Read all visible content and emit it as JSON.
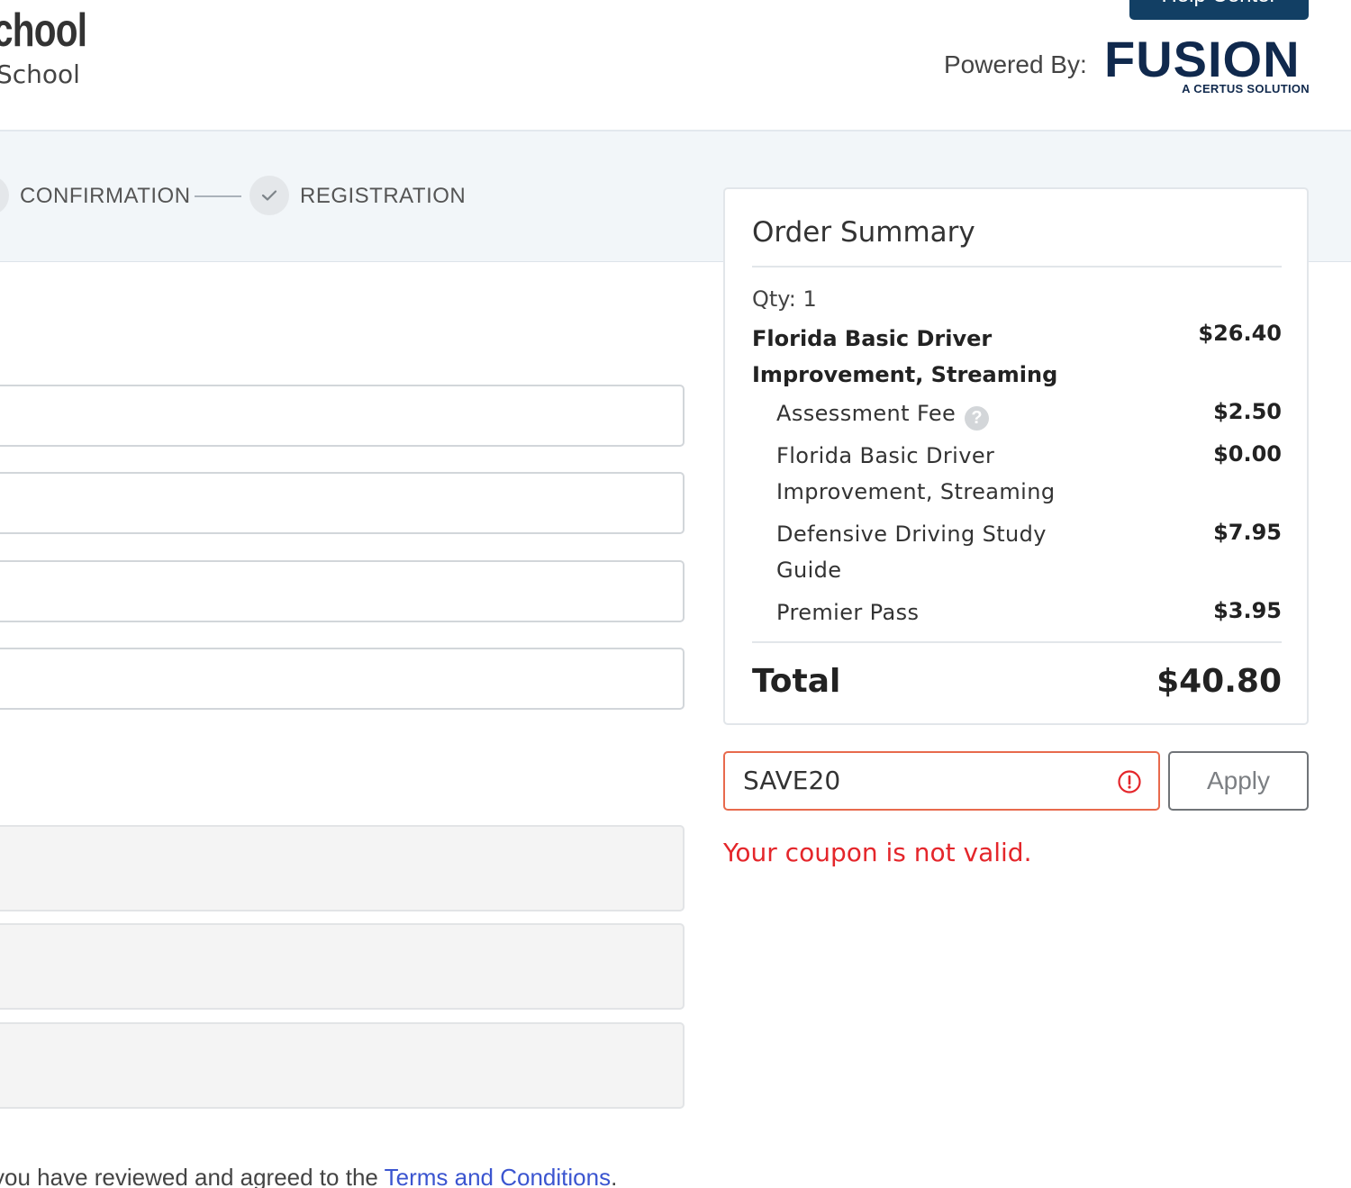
{
  "header": {
    "brand_title": "chool",
    "brand_subtitle": "School",
    "help_button": "Help Center",
    "powered_by": "Powered By:",
    "fusion_logo_text": "FUSION",
    "fusion_tagline": "A CERTUS SOLUTION"
  },
  "steps": [
    {
      "label": "CONFIRMATION",
      "state": "complete"
    },
    {
      "label": "REGISTRATION",
      "state": "complete"
    }
  ],
  "agreement": {
    "text": "you have reviewed and agreed to the ",
    "link": "Terms and Conditions",
    "end": "."
  },
  "order_summary": {
    "title": "Order Summary",
    "qty": "Qty: 1",
    "main_item": {
      "name": "Florida Basic Driver Improvement, Streaming",
      "price": "$26.40"
    },
    "sub_items": [
      {
        "name": "Assessment Fee",
        "price": "$2.50",
        "help_icon": "question-circle-icon"
      },
      {
        "name": "Florida Basic Driver Improvement, Streaming",
        "price": "$0.00"
      },
      {
        "name": "Defensive Driving Study Guide",
        "price": "$7.95"
      },
      {
        "name": "Premier Pass",
        "price": "$3.95"
      }
    ],
    "total_label": "Total",
    "total_value": "$40.80"
  },
  "coupon": {
    "value": "SAVE20",
    "apply_label": "Apply",
    "error_message": "Your coupon is not valid.",
    "error_color": "#e4262b"
  },
  "colors": {
    "primary_navy": "#123f64",
    "logo_navy": "#10294d",
    "link_blue": "#3b55d0",
    "error_border": "#e86a4d"
  }
}
